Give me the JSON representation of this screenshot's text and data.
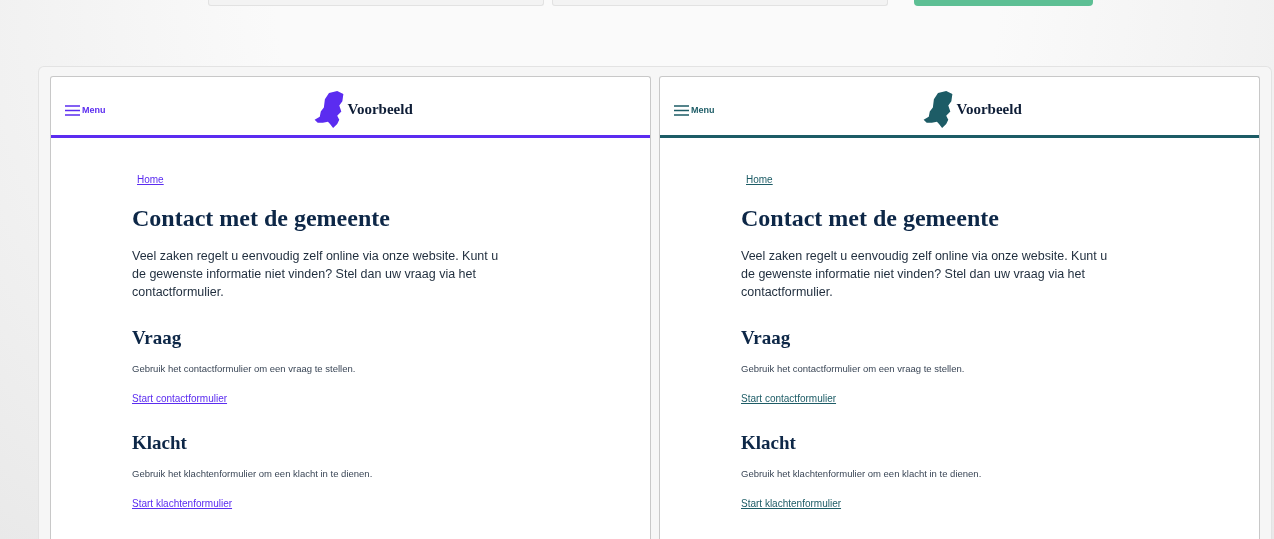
{
  "top_bar": {
    "fields": [
      {
        "kind": "field"
      },
      {
        "kind": "field"
      }
    ],
    "button": {
      "kind": "button"
    }
  },
  "previews": [
    {
      "color": "#5b2cf0",
      "menu_label": "Menu",
      "logo_text": "Voorbeeld",
      "breadcrumb": "Home",
      "title": "Contact met de gemeente",
      "intro": "Veel zaken regelt u eenvoudig zelf online via onze website. Kunt u de gewenste informatie niet vinden? Stel dan uw vraag via het contactformulier.",
      "sections": [
        {
          "heading": "Vraag",
          "text": "Gebruik het contactformulier om een vraag te stellen.",
          "link": "Start contactformulier"
        },
        {
          "heading": "Klacht",
          "text": "Gebruik het klachtenformulier om een klacht in te dienen.",
          "link": "Start klachtenformulier"
        }
      ]
    },
    {
      "color": "#1d5c66",
      "menu_label": "Menu",
      "logo_text": "Voorbeeld",
      "breadcrumb": "Home",
      "title": "Contact met de gemeente",
      "intro": "Veel zaken regelt u eenvoudig zelf online via onze website. Kunt u de gewenste informatie niet vinden? Stel dan uw vraag via het contactformulier.",
      "sections": [
        {
          "heading": "Vraag",
          "text": "Gebruik het contactformulier om een vraag te stellen.",
          "link": "Start contactformulier"
        },
        {
          "heading": "Klacht",
          "text": "Gebruik het klachtenformulier om een klacht in te dienen.",
          "link": "Start klachtenformulier"
        }
      ]
    }
  ]
}
